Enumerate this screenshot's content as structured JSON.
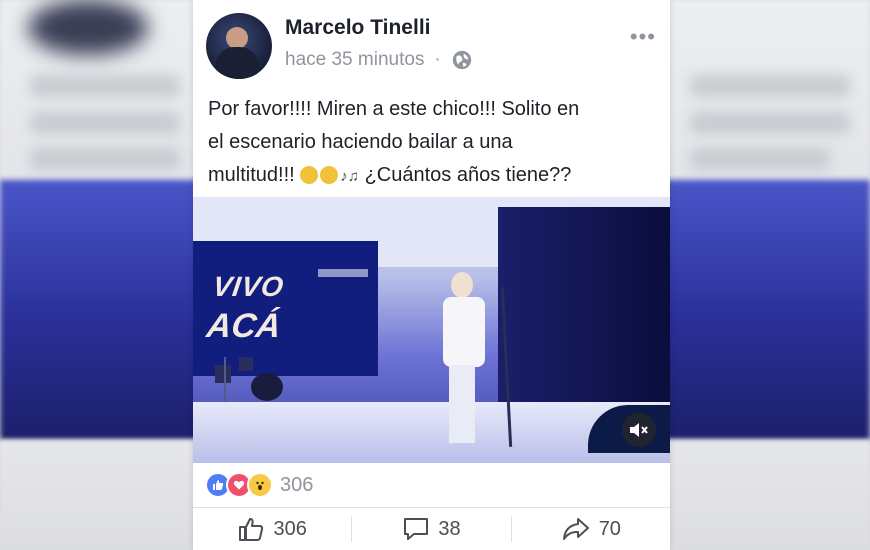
{
  "post": {
    "author": "Marcelo Tinelli",
    "timestamp": "hace 35 minutos",
    "separator": "·",
    "privacy_icon": "globe-icon",
    "more_icon": "more-options-icon",
    "more_glyph": "•••",
    "text_line1": "Por favor!!!! Miren a este chico!!! Solito en",
    "text_line2": "el escenario haciendo bailar a una",
    "text_line3_before": "multitud!!!",
    "text_line3_after": "¿Cuántos años tiene??"
  },
  "video": {
    "banner_line1": "VIVO",
    "banner_line2": "ACÁ",
    "mute_icon": "muted-speaker-icon"
  },
  "reactions": {
    "types": [
      "like",
      "love",
      "wow"
    ],
    "count": "306"
  },
  "actions": {
    "like_count": "306",
    "comment_count": "38",
    "share_count": "70"
  },
  "colors": {
    "brand_blue": "#4f7cf7",
    "love_red": "#f0506e",
    "wow_yellow": "#f7c944",
    "meta_gray": "#90949c"
  }
}
